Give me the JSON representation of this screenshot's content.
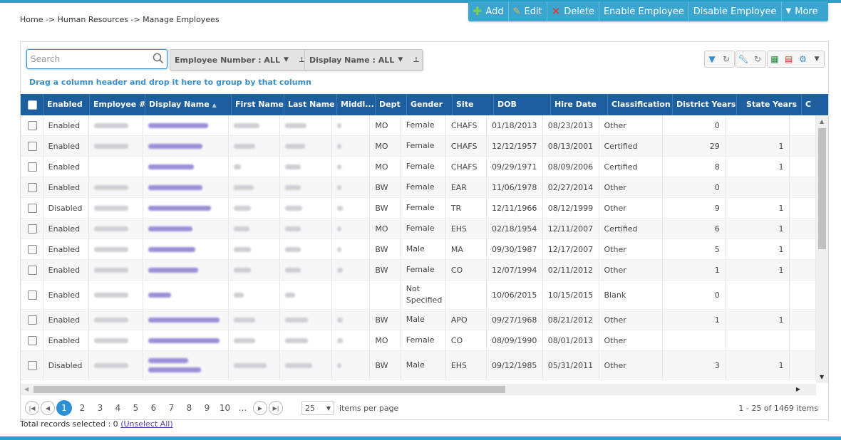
{
  "breadcrumb": "Home -> Human Resources -> Manage Employees",
  "toolbar": {
    "add": "Add",
    "edit": "Edit",
    "delete": "Delete",
    "enable": "Enable Employee",
    "disable": "Disable Employee",
    "more": "More"
  },
  "search": {
    "placeholder": "Search"
  },
  "filters": {
    "employee_number": "Employee Number : ALL",
    "display_name": "Display Name : ALL"
  },
  "group_hint": "Drag a column header and drop it here to group by that column",
  "columns": [
    "Enabled",
    "Employee #",
    "Display Name",
    "First Name",
    "Last Name",
    "Middl...",
    "Dept",
    "Gender",
    "Site",
    "DOB",
    "Hire Date",
    "Classification",
    "District Years",
    "State Years",
    "C"
  ],
  "rows": [
    {
      "enabled": "Enabled",
      "dept": "MO",
      "gender": "Female",
      "site": "CHAFS",
      "dob": "01/18/2013",
      "hire": "08/23/2013",
      "class": "Other",
      "district": "0",
      "state": ""
    },
    {
      "enabled": "Enabled",
      "dept": "MO",
      "gender": "Female",
      "site": "CHAFS",
      "dob": "12/12/1957",
      "hire": "08/13/2001",
      "class": "Certified",
      "district": "29",
      "state": "1"
    },
    {
      "enabled": "Enabled",
      "dept": "MO",
      "gender": "Female",
      "site": "CHAFS",
      "dob": "09/29/1971",
      "hire": "08/09/2006",
      "class": "Certified",
      "district": "8",
      "state": "1"
    },
    {
      "enabled": "Enabled",
      "dept": "BW",
      "gender": "Female",
      "site": "EAR",
      "dob": "11/06/1978",
      "hire": "02/27/2014",
      "class": "Other",
      "district": "0",
      "state": ""
    },
    {
      "enabled": "Disabled",
      "dept": "BW",
      "gender": "Female",
      "site": "TR",
      "dob": "12/11/1966",
      "hire": "08/12/1999",
      "class": "Other",
      "district": "9",
      "state": "1"
    },
    {
      "enabled": "Enabled",
      "dept": "MO",
      "gender": "Female",
      "site": "EHS",
      "dob": "02/18/1954",
      "hire": "12/11/2007",
      "class": "Certified",
      "district": "6",
      "state": "1"
    },
    {
      "enabled": "Enabled",
      "dept": "BW",
      "gender": "Male",
      "site": "MA",
      "dob": "09/30/1987",
      "hire": "12/17/2007",
      "class": "Other",
      "district": "5",
      "state": "1"
    },
    {
      "enabled": "Enabled",
      "dept": "BW",
      "gender": "Female",
      "site": "CO",
      "dob": "12/07/1994",
      "hire": "02/11/2012",
      "class": "Other",
      "district": "1",
      "state": "1"
    },
    {
      "enabled": "Enabled",
      "dept": "",
      "gender": "Not Specified",
      "site": "",
      "dob": "10/06/2015",
      "hire": "10/15/2015",
      "class": "Blank",
      "district": "0",
      "state": ""
    },
    {
      "enabled": "Enabled",
      "dept": "BW",
      "gender": "Male",
      "site": "APO",
      "dob": "09/27/1968",
      "hire": "08/21/2012",
      "class": "Other",
      "district": "1",
      "state": "1"
    },
    {
      "enabled": "Enabled",
      "dept": "MO",
      "gender": "Female",
      "site": "CO",
      "dob": "08/09/1990",
      "hire": "08/01/2013",
      "class": "Other",
      "district": "",
      "state": ""
    },
    {
      "enabled": "Disabled",
      "dept": "BW",
      "gender": "Male",
      "site": "EHS",
      "dob": "09/12/1985",
      "hire": "05/31/2011",
      "class": "Other",
      "district": "3",
      "state": "1"
    }
  ],
  "pager": {
    "current": "1",
    "pages": [
      "2",
      "3",
      "4",
      "5",
      "6",
      "7",
      "8",
      "9",
      "10",
      "..."
    ],
    "page_size": "25",
    "items_per_page": "items per page",
    "info": "1 - 25 of 1469 items"
  },
  "footer": {
    "selected": "Total records selected : 0",
    "unselect": "(Unselect All)"
  }
}
